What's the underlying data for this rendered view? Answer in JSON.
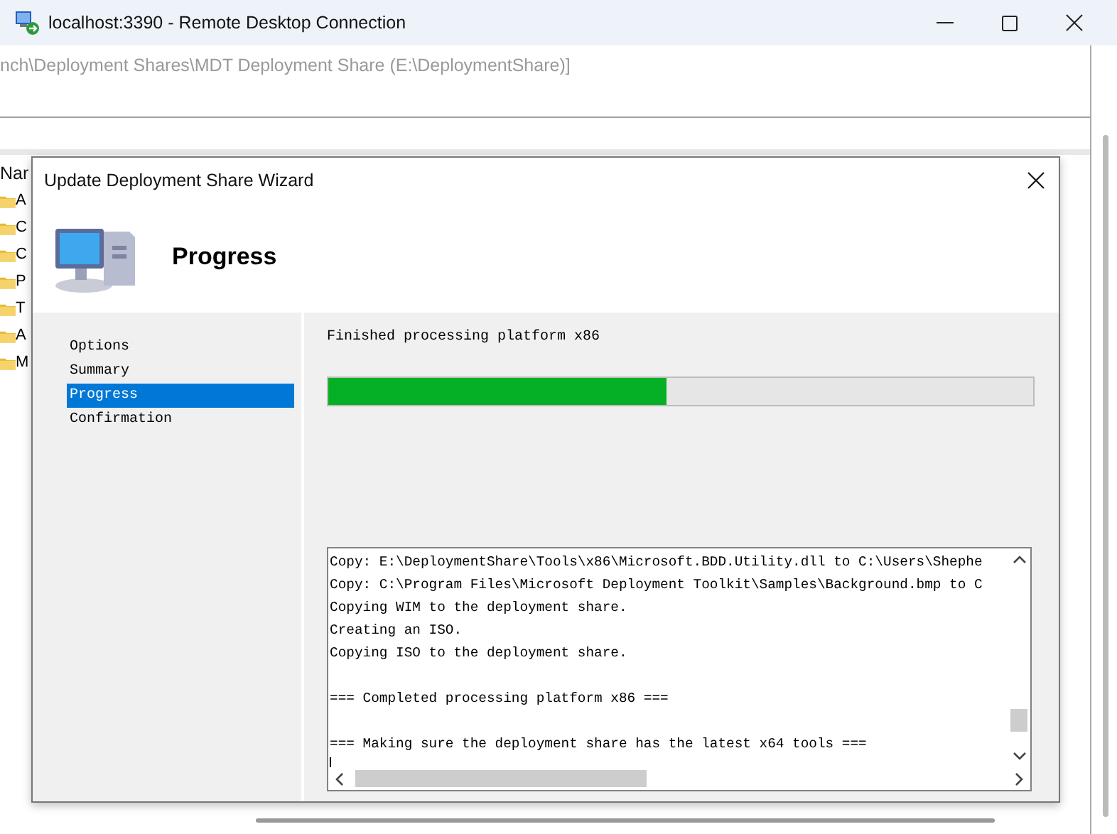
{
  "window": {
    "title": "localhost:3390 - Remote Desktop Connection"
  },
  "background_app": {
    "path": "nch\\Deployment Shares\\MDT Deployment Share (E:\\DeploymentShare)]",
    "list_header": "Nar",
    "list_items": [
      {
        "text": "A"
      },
      {
        "text": "C"
      },
      {
        "text": "C"
      },
      {
        "text": "P"
      },
      {
        "text": "T"
      },
      {
        "text": "A"
      },
      {
        "text": "M"
      }
    ]
  },
  "wizard": {
    "title": "Update Deployment Share Wizard",
    "heading": "Progress",
    "steps": [
      {
        "label": "Options",
        "selected": false
      },
      {
        "label": "Summary",
        "selected": false
      },
      {
        "label": "Progress",
        "selected": true
      },
      {
        "label": "Confirmation",
        "selected": false
      }
    ],
    "status": "Finished processing platform x86",
    "progress": {
      "level": 0.48
    },
    "log_blocks": [
      {
        "lines": [
          "Copy: E:\\DeploymentShare\\Tools\\x86\\Microsoft.BDD.Utility.dll to C:\\Users\\Shephe",
          "Copy: C:\\Program Files\\Microsoft Deployment Toolkit\\Samples\\Background.bmp to C",
          "Copying WIM to the deployment share.",
          "Creating an ISO.",
          "Copying ISO to the deployment share."
        ]
      },
      {
        "lines": [
          "=== Completed processing platform x86 ==="
        ]
      },
      {
        "lines": [
          "=== Making sure the deployment share has the latest x64 tools ==="
        ]
      }
    ]
  }
}
